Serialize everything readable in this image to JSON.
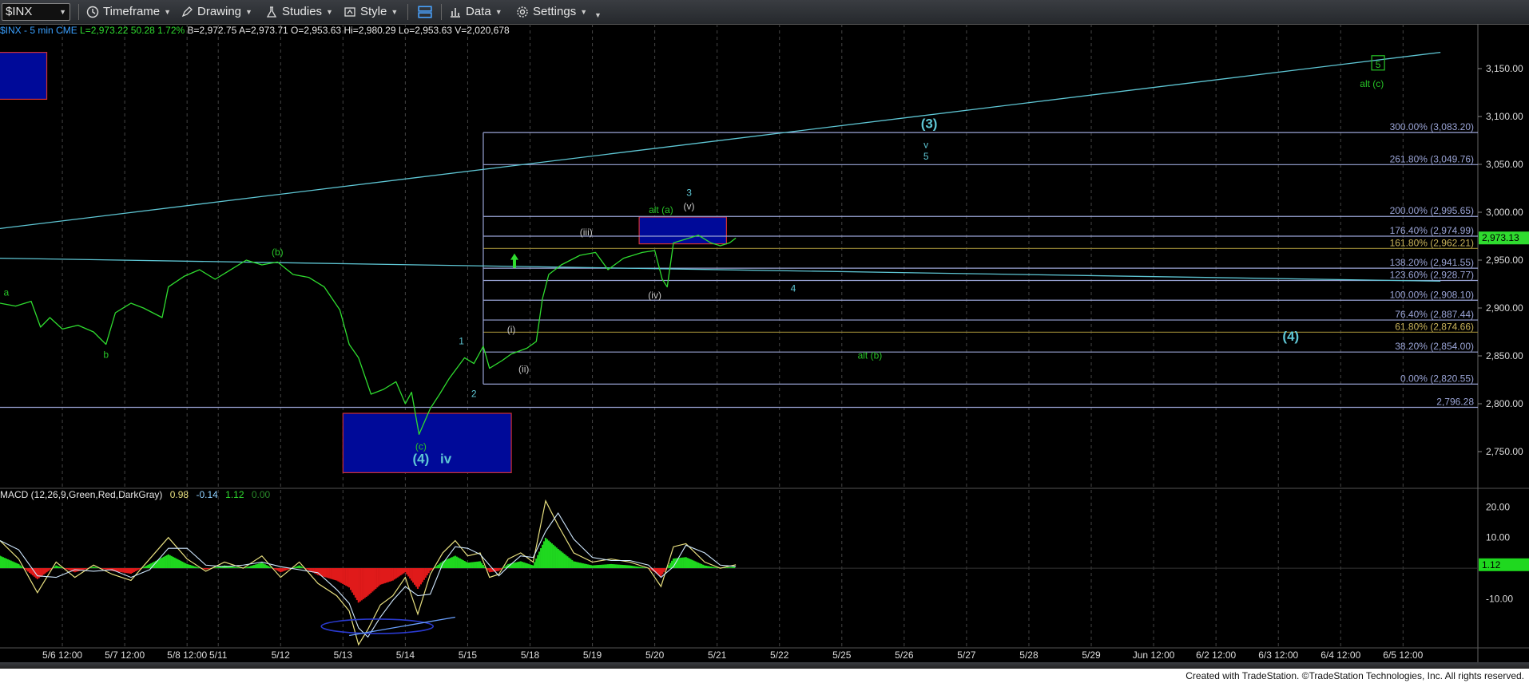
{
  "toolbar": {
    "symbol": "$INX",
    "timeframe": "Timeframe",
    "drawing": "Drawing",
    "studies": "Studies",
    "style": "Style",
    "data": "Data",
    "settings": "Settings"
  },
  "info": {
    "symbol": "$INX - 5 min",
    "exchange": "CME",
    "last": "L=2,973.22",
    "change": "50.28",
    "change_pct": "1.72%",
    "bid": "B=2,972.75",
    "ask": "A=2,973.71",
    "open": "O=2,953.63",
    "high": "Hi=2,980.29",
    "low": "Lo=2,953.63",
    "volume": "V=2,020,678"
  },
  "macd": {
    "label": "MACD (12,26,9,Green,Red,DarkGray)",
    "v1": "0.98",
    "v2": "-0.14",
    "v3": "1.12",
    "v4": "0.00",
    "current": "1.12"
  },
  "footer": "Created with TradeStation. ©TradeStation Technologies, Inc. All rights reserved.",
  "colors": {
    "price": "#2fdc2f",
    "fib_line": "#9aa4d6",
    "trend_line": "#5ec6d4",
    "wave_cyan": "#5ec6d4",
    "wave_green": "#27c427",
    "wave_white": "#c8c8c8",
    "box_fill": "#000a99",
    "macd_green": "#1fd81f",
    "macd_red": "#e01a1a",
    "current_price_tag": "#2fdc2f"
  },
  "chart_data": {
    "type": "line",
    "yaxis": {
      "range": [
        2715,
        3180
      ],
      "ticks": [
        2750,
        2800,
        2850,
        2900,
        2950,
        3000,
        3050,
        3100,
        3150
      ],
      "tick_labels": [
        "2,750.00",
        "2,800.00",
        "2,850.00",
        "2,900.00",
        "2,950.00",
        "3,000.00",
        "3,050.00",
        "3,100.00",
        "3,150.00"
      ]
    },
    "xaxis": {
      "range": [
        0,
        23.7
      ],
      "tick_positions": [
        1,
        2,
        3,
        3.5,
        4.5,
        5.5,
        6.5,
        7.5,
        8.5,
        9.5,
        10.5,
        11.5,
        12.5,
        13.5,
        14.5,
        15.5,
        16.5,
        17.5,
        18.5,
        19.5,
        20.5,
        21.5,
        22.5
      ],
      "tick_labels": [
        "5/6 12:00",
        "5/7 12:00",
        "5/8 12:00",
        "5/11",
        "5/12",
        "5/13",
        "5/14",
        "5/15",
        "5/18",
        "5/19",
        "5/20",
        "5/21",
        "5/22",
        "5/25",
        "5/26",
        "5/27",
        "5/28",
        "5/29",
        "Jun 12:00",
        "6/2 12:00",
        "6/3 12:00",
        "6/4 12:00",
        "6/5 12:00"
      ]
    },
    "series": [
      {
        "values": [
          [
            0,
            2905
          ],
          [
            0.25,
            2902
          ],
          [
            0.5,
            2907
          ],
          [
            0.65,
            2880
          ],
          [
            0.8,
            2890
          ],
          [
            1,
            2878
          ],
          [
            1.25,
            2882
          ],
          [
            1.5,
            2875
          ],
          [
            1.7,
            2862
          ],
          [
            1.85,
            2895
          ],
          [
            2.1,
            2905
          ],
          [
            2.3,
            2900
          ],
          [
            2.6,
            2890
          ],
          [
            2.7,
            2922
          ],
          [
            2.95,
            2933
          ],
          [
            3.2,
            2940
          ],
          [
            3.45,
            2930
          ],
          [
            3.65,
            2938
          ],
          [
            3.95,
            2950
          ],
          [
            4.2,
            2945
          ],
          [
            4.45,
            2948
          ],
          [
            4.7,
            2935
          ],
          [
            4.95,
            2932
          ],
          [
            5.2,
            2922
          ],
          [
            5.45,
            2898
          ],
          [
            5.6,
            2862
          ],
          [
            5.75,
            2848
          ],
          [
            5.95,
            2810
          ],
          [
            6.15,
            2815
          ],
          [
            6.35,
            2823
          ],
          [
            6.5,
            2800
          ],
          [
            6.6,
            2812
          ],
          [
            6.72,
            2768
          ],
          [
            6.9,
            2795
          ],
          [
            7.05,
            2810
          ],
          [
            7.2,
            2826
          ],
          [
            7.45,
            2848
          ],
          [
            7.6,
            2842
          ],
          [
            7.75,
            2860
          ],
          [
            7.85,
            2837
          ],
          [
            8.05,
            2845
          ],
          [
            8.2,
            2852
          ],
          [
            8.45,
            2858
          ],
          [
            8.6,
            2865
          ],
          [
            8.7,
            2910
          ],
          [
            8.8,
            2935
          ],
          [
            9.0,
            2945
          ],
          [
            9.3,
            2955
          ],
          [
            9.55,
            2958
          ],
          [
            9.75,
            2940
          ],
          [
            10.0,
            2952
          ],
          [
            10.3,
            2958
          ],
          [
            10.5,
            2960
          ],
          [
            10.62,
            2930
          ],
          [
            10.7,
            2922
          ],
          [
            10.8,
            2968
          ],
          [
            11.0,
            2972
          ],
          [
            11.2,
            2976
          ],
          [
            11.4,
            2968
          ],
          [
            11.55,
            2965
          ],
          [
            11.7,
            2968
          ],
          [
            11.8,
            2973
          ]
        ]
      },
      {
        "name": "MACD",
        "values": [
          [
            0,
            9
          ],
          [
            0.3,
            3
          ],
          [
            0.6,
            -8
          ],
          [
            0.9,
            2
          ],
          [
            1.2,
            -3
          ],
          [
            1.5,
            1
          ],
          [
            1.8,
            -2
          ],
          [
            2.1,
            -4
          ],
          [
            2.4,
            3
          ],
          [
            2.7,
            10
          ],
          [
            3.0,
            3
          ],
          [
            3.3,
            -1
          ],
          [
            3.6,
            2
          ],
          [
            3.9,
            0
          ],
          [
            4.2,
            4
          ],
          [
            4.5,
            -3
          ],
          [
            4.8,
            2
          ],
          [
            5.1,
            -5
          ],
          [
            5.4,
            -9
          ],
          [
            5.6,
            -14
          ],
          [
            5.75,
            -25
          ],
          [
            5.9,
            -20
          ],
          [
            6.1,
            -12
          ],
          [
            6.3,
            -9
          ],
          [
            6.5,
            -3
          ],
          [
            6.7,
            -15
          ],
          [
            6.9,
            -2
          ],
          [
            7.1,
            5
          ],
          [
            7.3,
            9
          ],
          [
            7.5,
            4
          ],
          [
            7.7,
            5
          ],
          [
            7.85,
            -3
          ],
          [
            8.0,
            -2
          ],
          [
            8.15,
            3
          ],
          [
            8.35,
            5
          ],
          [
            8.55,
            2
          ],
          [
            8.75,
            22
          ],
          [
            8.95,
            14
          ],
          [
            9.2,
            5
          ],
          [
            9.5,
            2
          ],
          [
            9.8,
            3
          ],
          [
            10.1,
            2
          ],
          [
            10.4,
            0
          ],
          [
            10.6,
            -6
          ],
          [
            10.8,
            7
          ],
          [
            11.0,
            8
          ],
          [
            11.3,
            2
          ],
          [
            11.55,
            0
          ],
          [
            11.8,
            1.12
          ]
        ]
      }
    ],
    "macd_axis": {
      "range": [
        -25,
        24
      ],
      "ticks": [
        20,
        10,
        -10
      ],
      "tick_labels": [
        "20.00",
        "10.00",
        "-10.00"
      ]
    },
    "fib_levels": [
      {
        "label": "300.00% (3,083.20)",
        "value": 3083.2
      },
      {
        "label": "261.80% (3,049.76)",
        "value": 3049.76
      },
      {
        "label": "200.00% (2,995.65)",
        "value": 2995.65
      },
      {
        "label": "176.40% (2,974.99)",
        "value": 2974.99
      },
      {
        "label": "161.80% (2,962.21)",
        "value": 2962.21
      },
      {
        "label": "138.20% (2,941.55)",
        "value": 2941.55
      },
      {
        "label": "123.60% (2,928.77)",
        "value": 2928.77
      },
      {
        "label": "100.00% (2,908.10)",
        "value": 2908.1
      },
      {
        "label": "76.40% (2,887.44)",
        "value": 2887.44
      },
      {
        "label": "61.80% (2,874.66)",
        "value": 2874.66
      },
      {
        "label": "38.20% (2,854.00)",
        "value": 2854
      },
      {
        "label": "0.00% (2,820.55)",
        "value": 2820.55
      },
      {
        "label": "2,796.28",
        "value": 2796.28
      }
    ],
    "current_price_label": "2,973.13",
    "annotations": [
      {
        "text": "a",
        "x": 0.1,
        "y": 2913,
        "color": "green"
      },
      {
        "text": "b",
        "x": 1.7,
        "y": 2848,
        "color": "green"
      },
      {
        "text": "(b)",
        "x": 4.45,
        "y": 2955,
        "color": "green"
      },
      {
        "text": "(c)",
        "x": 6.75,
        "y": 2752,
        "color": "green"
      },
      {
        "text": "(4)",
        "x": 6.75,
        "y": 2738,
        "color": "cyan"
      },
      {
        "text": "iv",
        "x": 7.15,
        "y": 2738,
        "color": "cyan"
      },
      {
        "text": "1",
        "x": 7.4,
        "y": 2862,
        "color": "cyan"
      },
      {
        "text": "2",
        "x": 7.6,
        "y": 2807,
        "color": "cyan"
      },
      {
        "text": "(i)",
        "x": 8.2,
        "y": 2874,
        "color": "white"
      },
      {
        "text": "(ii)",
        "x": 8.4,
        "y": 2833,
        "color": "white"
      },
      {
        "text": "(iii)",
        "x": 9.4,
        "y": 2976,
        "color": "white"
      },
      {
        "text": "(iv)",
        "x": 10.5,
        "y": 2910,
        "color": "white"
      },
      {
        "text": "alt (a)",
        "x": 10.6,
        "y": 2999,
        "color": "green"
      },
      {
        "text": "(v)",
        "x": 11.05,
        "y": 3003,
        "color": "white"
      },
      {
        "text": "3",
        "x": 11.05,
        "y": 3017,
        "color": "cyan"
      },
      {
        "text": "4",
        "x": 12.72,
        "y": 2917,
        "color": "cyan"
      },
      {
        "text": "alt (b)",
        "x": 13.95,
        "y": 2847,
        "color": "green"
      },
      {
        "text": "(3)",
        "x": 14.9,
        "y": 3088,
        "color": "cyan"
      },
      {
        "text": "v",
        "x": 14.85,
        "y": 3067,
        "color": "cyan"
      },
      {
        "text": "5",
        "x": 14.85,
        "y": 3055,
        "color": "cyan"
      },
      {
        "text": "(4)",
        "x": 20.7,
        "y": 2866,
        "color": "cyan"
      },
      {
        "text": "5",
        "x": 22.1,
        "y": 3151,
        "color": "green"
      },
      {
        "text": "alt (c)",
        "x": 22.0,
        "y": 3131,
        "color": "green"
      }
    ]
  }
}
